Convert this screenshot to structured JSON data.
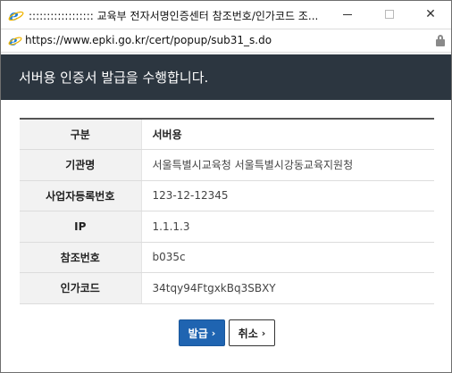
{
  "window": {
    "title": ":::::::::::::::::: 교육부 전자서명인증센터 참조번호/인가코드 조...",
    "minimize_icon": "minimize-icon",
    "maximize_icon": "maximize-icon",
    "close_icon": "close-icon",
    "close_glyph": "✕"
  },
  "addressbar": {
    "url": "https://www.epki.go.kr/cert/popup/sub31_s.do",
    "page_icon": "ie-page-icon",
    "lock_icon": "lock-icon"
  },
  "banner": {
    "title": "서버용 인증서 발급을 수행합니다."
  },
  "table": {
    "header_label": "구분",
    "header_value": "서버용",
    "rows": [
      {
        "label": "기관명",
        "value": "서울특별시교육청 서울특별시강동교육지원청"
      },
      {
        "label": "사업자등록번호",
        "value": "123-12-12345"
      },
      {
        "label": "IP",
        "value": "1.1.1.3"
      },
      {
        "label": "참조번호",
        "value": "b035c"
      },
      {
        "label": "인가코드",
        "value": "34tqy94FtgxkBq3SBXY"
      }
    ]
  },
  "buttons": {
    "issue_label": "발급",
    "cancel_label": "취소",
    "chevron_glyph": "›"
  },
  "colors": {
    "banner_bg": "#2c3640",
    "issue_button_bg": "#1f64b1"
  }
}
